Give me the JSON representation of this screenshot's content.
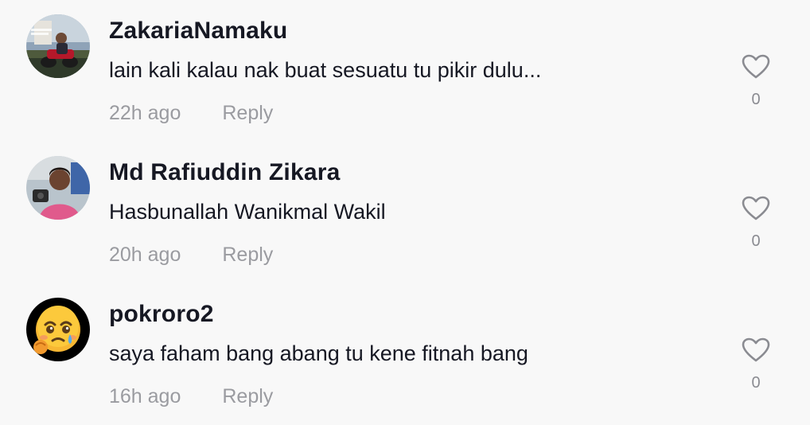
{
  "comments": [
    {
      "username": "ZakariaNamaku",
      "text": "lain kali kalau nak buat sesuatu tu pikir dulu...",
      "time": "22h ago",
      "reply_label": "Reply",
      "like_count": "0",
      "avatar": "motorbike-photo"
    },
    {
      "username": "Md Rafiuddin Zikara",
      "text": "Hasbunallah Wanikmal Wakil",
      "time": "20h ago",
      "reply_label": "Reply",
      "like_count": "0",
      "avatar": "person-photo"
    },
    {
      "username": "pokroro2",
      "text": "saya faham bang abang tu kene fitnah bang",
      "time": "16h ago",
      "reply_label": "Reply",
      "like_count": "0",
      "avatar": "crying-emoji"
    }
  ],
  "icons": {
    "like": "heart-outline-icon"
  },
  "colors": {
    "background": "#f8f8f8",
    "primary_text": "#161823",
    "secondary_text": "#9a9ba0",
    "icon_gray": "#8a8b91"
  }
}
